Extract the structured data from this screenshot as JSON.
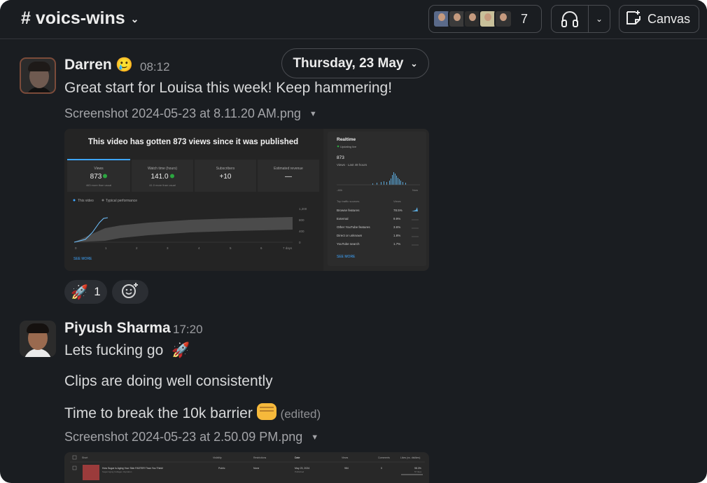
{
  "channel": {
    "name": "# voics-wins"
  },
  "header": {
    "member_count": "7",
    "canvas_label": "Canvas",
    "icons": [
      "chevron-down-icon",
      "headphones-icon",
      "canvas-icon"
    ]
  },
  "date_divider": "Thursday, 23 May",
  "messages": [
    {
      "author": "Darren",
      "status_emoji": "🥲",
      "time": "08:12",
      "text": "Great start for Louisa this week! Keep hammering!",
      "attachment": "Screenshot 2024-05-23 at 8.11.20 AM.png",
      "reaction": {
        "emoji": "🚀",
        "count": "1"
      }
    },
    {
      "author": "Piyush Sharma",
      "time": "17:20",
      "lines": [
        "Lets fucking go",
        "Clips are doing well consistently",
        "Time to break the 10k barrier"
      ],
      "edited": "(edited)",
      "attachment": "Screenshot 2024-05-23 at 2.50.09 PM.png"
    }
  ],
  "analytics_shot": {
    "headline": "This video has gotten 873 views since it was published",
    "cards": [
      {
        "label": "Views",
        "value": "873",
        "note": "463 more than usual"
      },
      {
        "label": "Watch time (hours)",
        "value": "141.0",
        "note": "41.0 more than usual"
      },
      {
        "label": "Subscribers",
        "value": "+10",
        "note": ""
      },
      {
        "label": "Estimated revenue",
        "value": "—",
        "note": ""
      }
    ],
    "legend": [
      "This video",
      "Typical performance"
    ],
    "x_ticks": [
      "0",
      "1",
      "2",
      "3",
      "4",
      "5",
      "6",
      "7 days"
    ],
    "y_ticks": [
      "1,200",
      "800",
      "400",
      "0"
    ],
    "see_more": "SEE MORE",
    "realtime": {
      "title": "Realtime",
      "status": "Updating live",
      "value": "873",
      "range": "Views · Last 48 hours",
      "axis": [
        "-48h",
        "Now"
      ],
      "table_header": [
        "Top traffic sources",
        "Views"
      ],
      "sources": [
        {
          "name": "Browse features",
          "pct": "78.5%"
        },
        {
          "name": "External",
          "pct": "9.9%"
        },
        {
          "name": "Other YouTube features",
          "pct": "3.6%"
        },
        {
          "name": "Direct or unknown",
          "pct": "1.8%"
        },
        {
          "name": "YouTube search",
          "pct": "1.7%"
        }
      ],
      "see_more": "SEE MORE"
    }
  },
  "table_shot": {
    "headers": [
      "Short",
      "Visibility",
      "Restrictions",
      "Date",
      "Views",
      "Comments",
      "Likes (vs. dislikes)"
    ],
    "row": {
      "title": "How Sugar is Aging Your Skin FASTER Than You Think!",
      "subtitle": "Sugar Aging Collagen Glycation",
      "visibility": "Public",
      "restrictions": "None",
      "date": "May 23, 2024",
      "date_sub": "Published",
      "views": "984",
      "comments": "0",
      "likes": "98.3%",
      "likes_sub": "57 likes"
    }
  },
  "colors": {
    "background": "#1a1d21",
    "border": "#4a4c51",
    "text": "#d8d9da",
    "muted": "#9b9ca0"
  }
}
